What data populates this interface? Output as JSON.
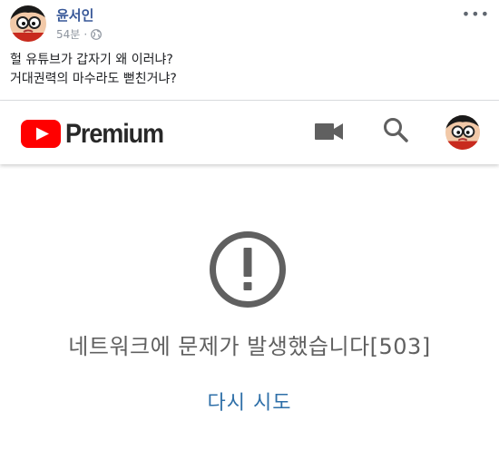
{
  "post": {
    "author": "윤서인",
    "time": "54분",
    "more_label": "•••",
    "lines": [
      "헐 유튜브가 갑자기 왜 이러냐?",
      "거대권력의 마수라도 뻗친거냐?"
    ]
  },
  "youtube": {
    "brand": "Premium",
    "accent": "#ff0000",
    "error_message": "네트워크에 문제가 발생했습니다[503]",
    "retry_label": "다시 시도"
  },
  "icons": {
    "privacy": "globe-icon",
    "logo": "youtube-play-icon",
    "camera": "video-camera-icon",
    "search": "search-icon",
    "error": "exclamation-circle-icon"
  }
}
